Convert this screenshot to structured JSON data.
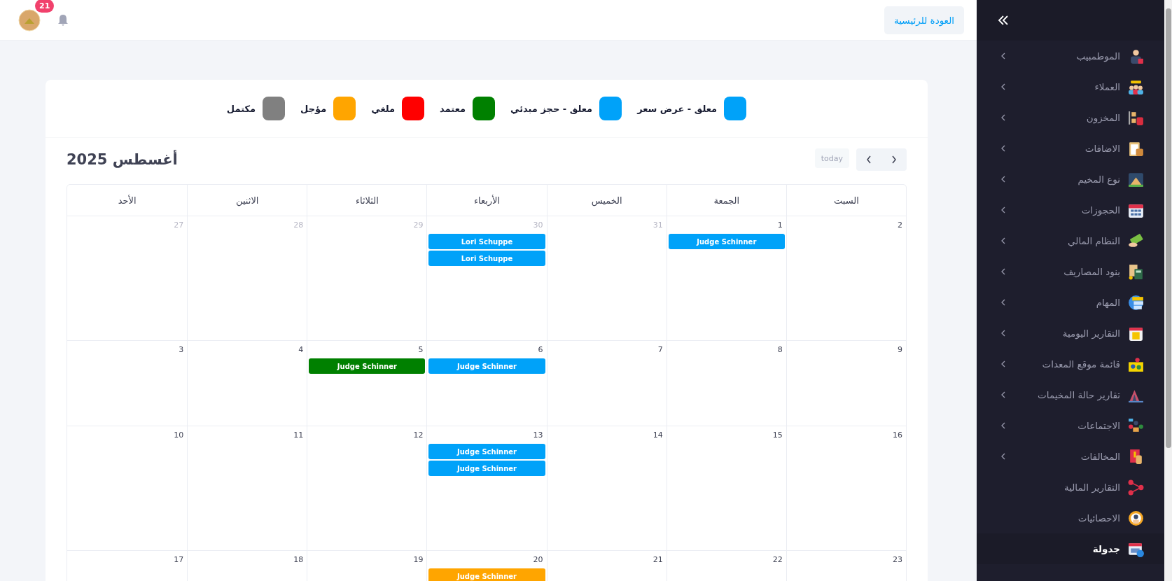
{
  "topbar": {
    "notification_count": "21",
    "home_button": "العودة للرئيسية"
  },
  "legend": [
    {
      "label": "معلق - عرض سعر",
      "color": "#00a2f9"
    },
    {
      "label": "معلق - حجز مبدئي",
      "color": "#00a2f9"
    },
    {
      "label": "معتمد",
      "color": "#008000"
    },
    {
      "label": "ملغي",
      "color": "#ff0000"
    },
    {
      "label": "مؤجل",
      "color": "#ffa500"
    },
    {
      "label": "مكتمل",
      "color": "#808080"
    }
  ],
  "calendar": {
    "title": "أغسطس 2025",
    "today_button": {
      "label": "today",
      "disabled": true
    },
    "weekdays": [
      "السبت",
      "الجمعة",
      "الخميس",
      "الأربعاء",
      "الثلاثاء",
      "الاثنين",
      "الأحد"
    ],
    "weeks": [
      [
        {
          "day": "2",
          "other_month": false
        },
        {
          "day": "1",
          "other_month": false,
          "events": [
            {
              "title": "Judge Schinner",
              "color": "#00a2f9"
            }
          ]
        },
        {
          "day": "31",
          "other_month": true
        },
        {
          "day": "30",
          "other_month": true,
          "events": [
            {
              "title": "Lori Schuppe",
              "color": "#00a2f9"
            },
            {
              "title": "Lori Schuppe",
              "color": "#00a2f9"
            }
          ]
        },
        {
          "day": "29",
          "other_month": true
        },
        {
          "day": "28",
          "other_month": true
        },
        {
          "day": "27",
          "other_month": true
        }
      ],
      [
        {
          "day": "9",
          "other_month": false
        },
        {
          "day": "8",
          "other_month": false
        },
        {
          "day": "7",
          "other_month": false
        },
        {
          "day": "6",
          "other_month": false,
          "events": [
            {
              "title": "Judge Schinner",
              "color": "#00a2f9"
            }
          ]
        },
        {
          "day": "5",
          "other_month": false,
          "events": [
            {
              "title": "Judge Schinner",
              "color": "#008000"
            }
          ]
        },
        {
          "day": "4",
          "other_month": false
        },
        {
          "day": "3",
          "other_month": false
        }
      ],
      [
        {
          "day": "16",
          "other_month": false
        },
        {
          "day": "15",
          "other_month": false
        },
        {
          "day": "14",
          "other_month": false
        },
        {
          "day": "13",
          "other_month": false,
          "events": [
            {
              "title": "Judge Schinner",
              "color": "#00a2f9"
            },
            {
              "title": "Judge Schinner",
              "color": "#00a2f9"
            }
          ]
        },
        {
          "day": "12",
          "other_month": false
        },
        {
          "day": "11",
          "other_month": false
        },
        {
          "day": "10",
          "other_month": false
        }
      ],
      [
        {
          "day": "23",
          "other_month": false
        },
        {
          "day": "22",
          "other_month": false
        },
        {
          "day": "21",
          "other_month": false
        },
        {
          "day": "20",
          "other_month": false,
          "events": [
            {
              "title": "Judge Schinner",
              "color": "#ffa500"
            }
          ]
        },
        {
          "day": "19",
          "other_month": false
        },
        {
          "day": "18",
          "other_month": false
        },
        {
          "day": "17",
          "other_month": false
        }
      ]
    ]
  },
  "sidebar": {
    "items": [
      {
        "label": "الموطمبيب",
        "has_submenu": true,
        "selected": false
      },
      {
        "label": "العملاء",
        "has_submenu": true,
        "selected": false
      },
      {
        "label": "المخزون",
        "has_submenu": true,
        "selected": false
      },
      {
        "label": "الاضافات",
        "has_submenu": true,
        "selected": false
      },
      {
        "label": "نوع المخيم",
        "has_submenu": true,
        "selected": false
      },
      {
        "label": "الحجوزات",
        "has_submenu": true,
        "selected": false
      },
      {
        "label": "النظام المالي",
        "has_submenu": true,
        "selected": false
      },
      {
        "label": "بنود المصاريف",
        "has_submenu": true,
        "selected": false
      },
      {
        "label": "المهام",
        "has_submenu": true,
        "selected": false
      },
      {
        "label": "التقارير اليومية",
        "has_submenu": true,
        "selected": false
      },
      {
        "label": "قائمة موقع المعدات",
        "has_submenu": true,
        "selected": false
      },
      {
        "label": "تقارير حالة المخيمات",
        "has_submenu": true,
        "selected": false
      },
      {
        "label": "الاجتماعات",
        "has_submenu": true,
        "selected": false
      },
      {
        "label": "المخالفات",
        "has_submenu": true,
        "selected": false
      },
      {
        "label": "التقارير المالية",
        "has_submenu": false,
        "selected": false
      },
      {
        "label": "الاحصائيات",
        "has_submenu": false,
        "selected": false
      },
      {
        "label": "جدولة",
        "has_submenu": false,
        "selected": true
      }
    ]
  }
}
